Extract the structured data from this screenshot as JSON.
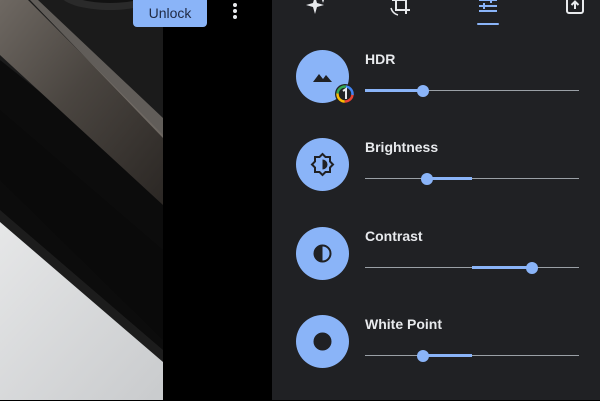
{
  "canvas": {
    "unlock_label": "Unlock",
    "more_menu_icon": "more-vert-icon"
  },
  "tabs": [
    {
      "name": "auto-enhance",
      "icon": "sparkle-icon",
      "active": false
    },
    {
      "name": "crop-rotate",
      "icon": "crop-rotate-icon",
      "active": false
    },
    {
      "name": "adjust",
      "icon": "tune-sliders-icon",
      "active": true
    },
    {
      "name": "export",
      "icon": "export-box-icon",
      "active": false
    }
  ],
  "adjustments": [
    {
      "label": "HDR",
      "icon": "landscape-icon",
      "value": 0.27,
      "origin": 0.0,
      "badge_icon": "color-ring-badge-icon"
    },
    {
      "label": "Brightness",
      "icon": "brightness-icon",
      "value": 0.29,
      "origin": 0.5
    },
    {
      "label": "Contrast",
      "icon": "contrast-icon",
      "value": 0.78,
      "origin": 0.5
    },
    {
      "label": "White Point",
      "icon": "white-point-icon",
      "value": 0.27,
      "origin": 0.5
    }
  ],
  "colors": {
    "accent": "#8ab4f8",
    "panel_bg": "#202124",
    "label_text": "#e8eaed",
    "track": "#9aa0a6"
  }
}
